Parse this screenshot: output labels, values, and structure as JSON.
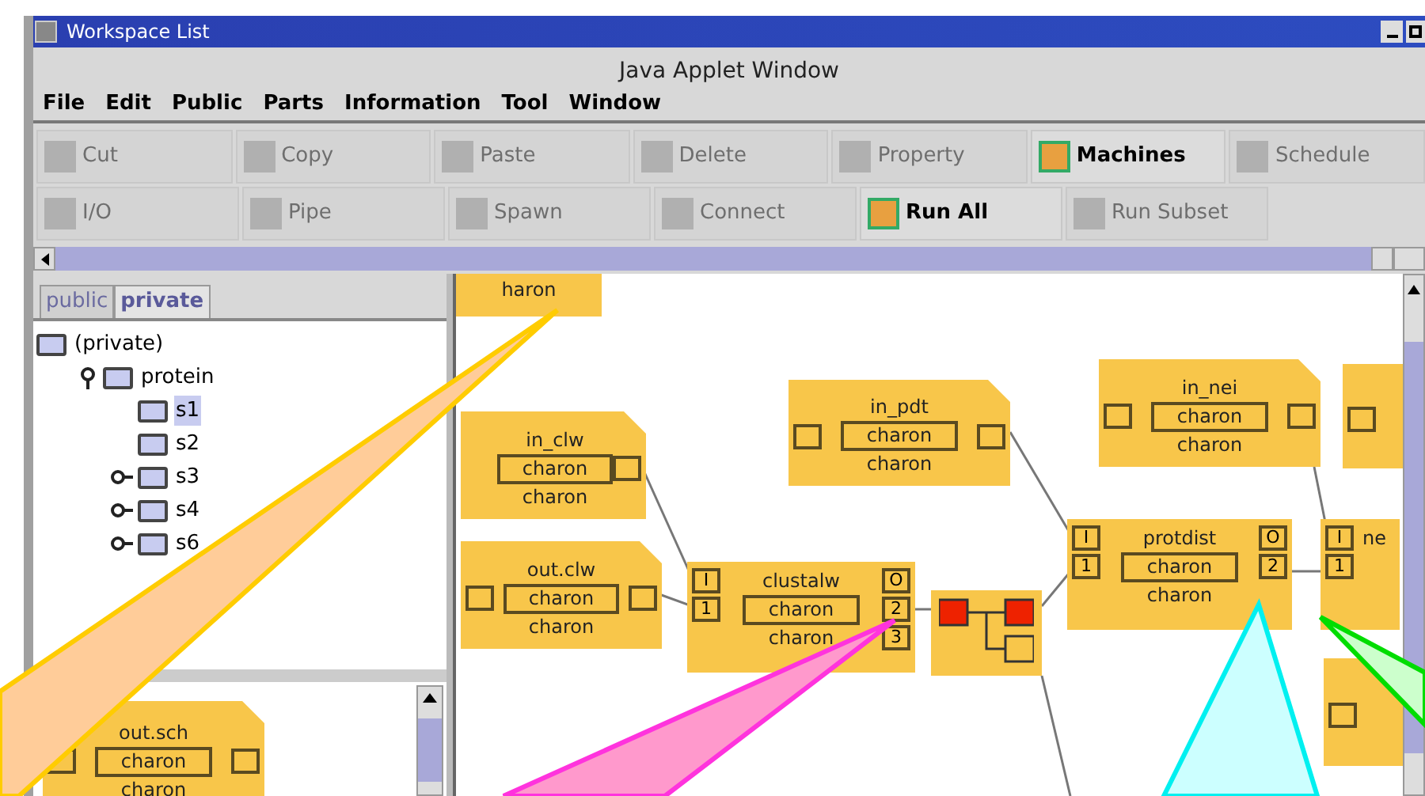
{
  "window": {
    "title": "Workspace List"
  },
  "applet_title": "Java Applet Window",
  "menu": [
    "File",
    "Edit",
    "Public",
    "Parts",
    "Information",
    "Tool",
    "Window"
  ],
  "toolbar": [
    [
      {
        "label": "Cut",
        "disabled": true
      },
      {
        "label": "Copy",
        "disabled": true
      },
      {
        "label": "Paste",
        "disabled": true
      },
      {
        "label": "Delete",
        "disabled": true
      },
      {
        "label": "Property",
        "disabled": true
      },
      {
        "label": "Machines",
        "disabled": false
      },
      {
        "label": "Schedule",
        "disabled": true
      }
    ],
    [
      {
        "label": "I/O",
        "disabled": true
      },
      {
        "label": "Pipe",
        "disabled": true
      },
      {
        "label": "Spawn",
        "disabled": true
      },
      {
        "label": "Connect",
        "disabled": true
      },
      {
        "label": "Run All",
        "disabled": false
      },
      {
        "label": "Run Subset",
        "disabled": true
      }
    ]
  ],
  "tabs": [
    {
      "label": "public",
      "selected": false
    },
    {
      "label": "private",
      "selected": true
    }
  ],
  "tree": [
    {
      "label": "(private)",
      "kind": "root",
      "selected": false,
      "children": [
        {
          "label": "protein",
          "kind": "branch",
          "expanded": true,
          "selected": false,
          "children": [
            {
              "label": "s1",
              "kind": "leaf",
              "selected": true
            },
            {
              "label": "s2",
              "kind": "leaf",
              "selected": false
            },
            {
              "label": "s3",
              "kind": "branch",
              "expanded": false,
              "selected": false
            },
            {
              "label": "s4",
              "kind": "branch",
              "expanded": false,
              "selected": false
            },
            {
              "label": "s6",
              "kind": "branch",
              "expanded": false,
              "selected": false
            }
          ]
        }
      ]
    }
  ],
  "palette": [
    {
      "kind": "file",
      "title": "out.sch",
      "host": "charon",
      "user": "charon",
      "left_port": true,
      "right_port": true
    }
  ],
  "nodes": [
    {
      "kind": "file",
      "user": "haron",
      "left_port": false,
      "right_port": false
    },
    {
      "kind": "file",
      "title": "in_nei",
      "host": "charon",
      "user": "charon",
      "left_port": true,
      "right_port": true
    },
    {
      "kind": "file",
      "left_port": true,
      "right_port": false
    },
    {
      "kind": "file",
      "title": "in_pdt",
      "host": "charon",
      "user": "charon",
      "left_port": true,
      "right_port": true
    },
    {
      "kind": "file",
      "title": "in_clw",
      "host": "charon",
      "user": "charon",
      "left_port": false,
      "right_port": true
    },
    {
      "kind": "program",
      "title": "protdist",
      "host": "charon",
      "user": "charon",
      "in_ports": [
        "I",
        "1"
      ],
      "out_ports": [
        "O",
        "2"
      ]
    },
    {
      "kind": "program",
      "title": "ne",
      "in_ports": [
        "I",
        "1"
      ]
    },
    {
      "kind": "file",
      "title": "out.clw",
      "host": "charon",
      "user": "charon",
      "left_port": true,
      "right_port": true
    },
    {
      "kind": "program",
      "title": "clustalw",
      "host": "charon",
      "user": "charon",
      "in_ports": [
        "I",
        "1"
      ],
      "out_ports": [
        "O",
        "2",
        "3"
      ]
    },
    {
      "kind": "merge"
    },
    {
      "kind": "file",
      "left_port": true,
      "right_port": false
    }
  ]
}
